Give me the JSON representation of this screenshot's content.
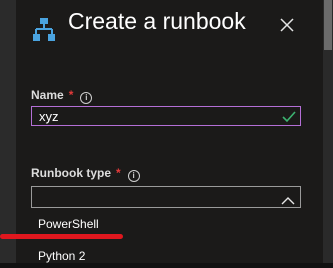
{
  "blade": {
    "title": "Create a runbook",
    "title_icon": "runbook-hierarchy-icon",
    "close_icon": "close-icon"
  },
  "form": {
    "name": {
      "label": "Name",
      "required_mark": "*",
      "value": "xyz",
      "valid_icon": "checkmark-icon"
    },
    "runbook_type": {
      "label": "Runbook type",
      "required_mark": "*",
      "selected_value": "",
      "options": [
        "PowerShell",
        "Python 2"
      ]
    }
  },
  "colors": {
    "accent_border": "#b46fd6",
    "check": "#3cb371",
    "required": "#e43a3a",
    "annotation_underline": "#e0171e",
    "icon_blue": "#4aa3df"
  }
}
